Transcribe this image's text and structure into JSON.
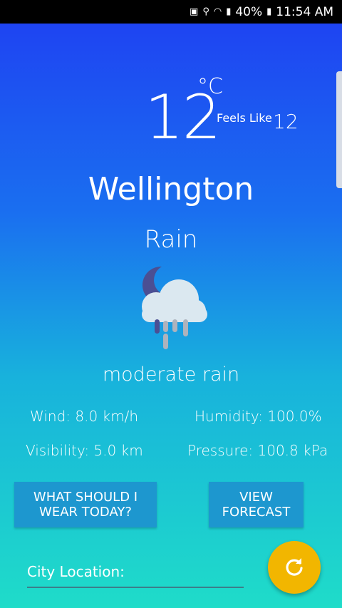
{
  "status_bar": {
    "battery": "40%",
    "time": "11:54 AM"
  },
  "weather": {
    "temperature": "12",
    "unit": "°C",
    "feels_like_label": "Feels Like",
    "feels_like_value": "12",
    "city": "Wellington",
    "condition": "Rain",
    "icon": "rain-cloud-moon-icon",
    "description": "moderate rain"
  },
  "stats": {
    "wind": "Wind: 8.0 km/h",
    "humidity": "Humidity: 100.0%",
    "visibility": "Visibility: 5.0 km",
    "pressure": "Pressure: 100.8 kPa"
  },
  "buttons": {
    "wear_line1": "WHAT SHOULD I",
    "wear_line2": "WEAR TODAY?",
    "forecast_line1": "VIEW",
    "forecast_line2": "FORECAST"
  },
  "location": {
    "label": "City Location:"
  },
  "colors": {
    "fab": "#f2b600",
    "button": "#1d97cf"
  }
}
